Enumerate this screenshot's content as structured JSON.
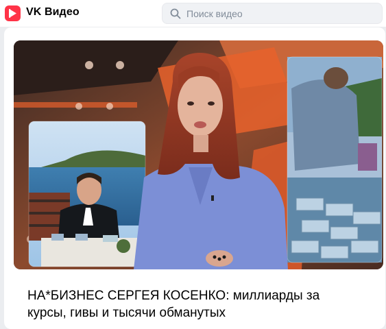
{
  "header": {
    "brand": "VK Видео",
    "logo_icon": "vk-video-play-icon",
    "search": {
      "placeholder": "Поиск видео",
      "icon": "search-icon"
    }
  },
  "video": {
    "title": "НА*БИЗНЕС СЕРГЕЯ КОСЕНКО: миллиарды за курсы, гивы и тысячи обманутых",
    "thumbnail": "video-thumbnail"
  },
  "colors": {
    "brand_red": "#ff3347",
    "page_bg": "#ebedf0",
    "thumb_orange": "#e8612c"
  }
}
